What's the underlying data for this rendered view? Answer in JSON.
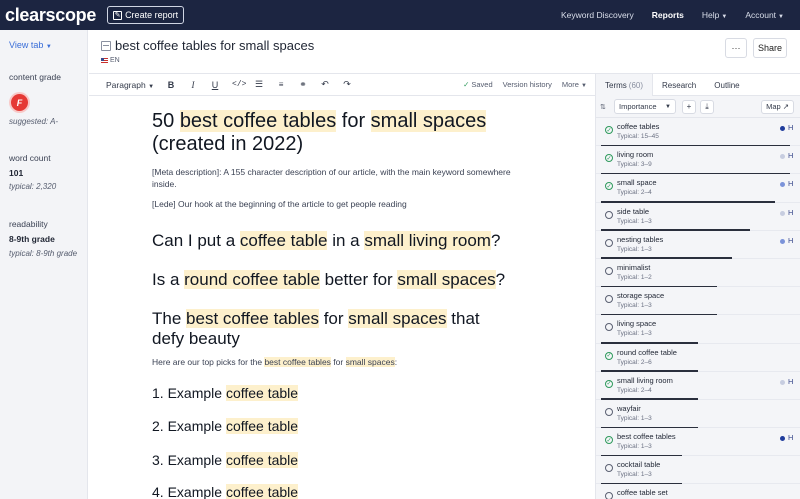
{
  "topnav": {
    "logo": "clearscope",
    "create_report": "Create report",
    "links": [
      {
        "label": "Keyword Discovery",
        "active": false,
        "caret": false
      },
      {
        "label": "Reports",
        "active": true,
        "caret": false
      },
      {
        "label": "Help",
        "active": false,
        "caret": true
      },
      {
        "label": "Account",
        "active": false,
        "caret": true
      }
    ]
  },
  "sidebar": {
    "view_tab": "View tab",
    "content_grade_label": "content grade",
    "grade": "F",
    "suggested": "suggested: A-",
    "word_count_label": "word count",
    "word_count": "101",
    "word_count_typical": "typical: 2,320",
    "readability_label": "readability",
    "readability": "8-9th grade",
    "readability_typical": "typical: 8-9th grade"
  },
  "doc": {
    "title": "best coffee tables for small spaces",
    "lang": "EN",
    "more": "···",
    "share": "Share"
  },
  "toolbar": {
    "paragraph": "Paragraph",
    "saved": "Saved",
    "version_history": "Version history",
    "more": "More"
  },
  "editor": {
    "h1_a": "50 ",
    "h1_b": "best coffee tables",
    "h1_c": " for ",
    "h1_d": "small spaces",
    "h1_e": " (created in 2022)",
    "meta": "[Meta description]: A 155 character description of our article, with the main keyword somewhere inside.",
    "lede": "[Lede] Our hook at the beginning of the article to get people reading",
    "q1_a": "Can I put a ",
    "q1_b": "coffee table",
    "q1_c": " in a ",
    "q1_d": "small living room",
    "q1_e": "?",
    "q2_a": "Is a ",
    "q2_b": "round coffee table",
    "q2_c": " better for ",
    "q2_d": "small spaces",
    "q2_e": "?",
    "q3_a": "The ",
    "q3_b": "best coffee tables",
    "q3_c": " for ",
    "q3_d": "small spaces",
    "q3_e": " that defy beauty",
    "picks_a": "Here are our top picks for the ",
    "picks_b": "best coffee tables",
    "picks_c": " for ",
    "picks_d": "small spaces",
    "picks_e": ":",
    "items": [
      {
        "num": "1. Example ",
        "hl": "coffee table"
      },
      {
        "num": "2. Example ",
        "hl": "coffee table"
      },
      {
        "num": "3. Example ",
        "hl": "coffee table"
      },
      {
        "num": "4. Example ",
        "hl": "coffee table"
      }
    ]
  },
  "panel": {
    "tabs": [
      {
        "label": "Terms",
        "count": "(60)"
      },
      {
        "label": "Research",
        "count": ""
      },
      {
        "label": "Outline",
        "count": ""
      }
    ],
    "sort": "Importance",
    "add": "+",
    "download": "⤓",
    "map": "Map",
    "terms": [
      {
        "name": "coffee tables",
        "typical": "Typical: 15–45",
        "done": true,
        "dot": "#1f3c9c",
        "heading": "H",
        "fill": 0.98
      },
      {
        "name": "living room",
        "typical": "Typical: 3–9",
        "done": true,
        "dot": "#c7cde0",
        "heading": "H",
        "fill": 0.98
      },
      {
        "name": "small space",
        "typical": "Typical: 2–4",
        "done": true,
        "dot": "#7b93d9",
        "heading": "H",
        "fill": 0.9
      },
      {
        "name": "side table",
        "typical": "Typical: 1–3",
        "done": false,
        "dot": "#c7cde0",
        "heading": "H",
        "fill": 0.77
      },
      {
        "name": "nesting tables",
        "typical": "Typical: 1–3",
        "done": false,
        "dot": "#7b93d9",
        "heading": "H",
        "fill": 0.68
      },
      {
        "name": "minimalist",
        "typical": "Typical: 1–2",
        "done": false,
        "dot": "",
        "heading": "",
        "fill": 0.6
      },
      {
        "name": "storage space",
        "typical": "Typical: 1–3",
        "done": false,
        "dot": "",
        "heading": "",
        "fill": 0.6
      },
      {
        "name": "living space",
        "typical": "Typical: 1–3",
        "done": false,
        "dot": "",
        "heading": "",
        "fill": 0.5
      },
      {
        "name": "round coffee table",
        "typical": "Typical: 2–6",
        "done": true,
        "dot": "",
        "heading": "",
        "fill": 0.5
      },
      {
        "name": "small living room",
        "typical": "Typical: 2–4",
        "done": true,
        "dot": "#c7cde0",
        "heading": "H",
        "fill": 0.5
      },
      {
        "name": "wayfair",
        "typical": "Typical: 1–3",
        "done": false,
        "dot": "",
        "heading": "",
        "fill": 0.5
      },
      {
        "name": "best coffee tables",
        "typical": "Typical: 1–3",
        "done": true,
        "dot": "#1f3c9c",
        "heading": "H",
        "fill": 0.42
      },
      {
        "name": "cocktail table",
        "typical": "Typical: 1–3",
        "done": false,
        "dot": "",
        "heading": "",
        "fill": 0.42
      },
      {
        "name": "coffee table set",
        "typical": "",
        "done": false,
        "dot": "",
        "heading": "",
        "fill": 0.42
      }
    ]
  }
}
